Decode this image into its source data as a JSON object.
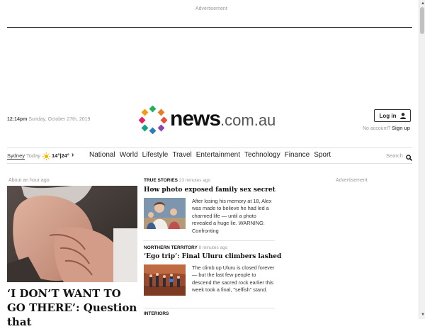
{
  "ads": {
    "top_label": "Advertisement",
    "side_label": "Advertisement"
  },
  "header": {
    "time": "12:14pm",
    "date": "Sunday, October 27th, 2019",
    "logo_main": "news",
    "logo_suffix": ".com.au",
    "login_label": "Log in",
    "no_account": "No account?",
    "signup_label": "Sign up"
  },
  "nav": {
    "location": "Sydney",
    "today": "Today",
    "temp": "14°|24°",
    "items": [
      "National",
      "World",
      "Lifestyle",
      "Travel",
      "Entertainment",
      "Technology",
      "Finance",
      "Sport"
    ],
    "search_label": "Search"
  },
  "main_story": {
    "ago": "About an hour ago",
    "headline": "‘I DON’T WANT TO GO THERE’: Question that"
  },
  "stories": [
    {
      "kicker": "TRUE STORIES",
      "ago": "23 minutes ago",
      "title": "How photo exposed family sex secret",
      "blurb": "After losing his memory at 18, Alex was made to believe he had led a charmed life — until a photo revealed a huge lie. WARNING: Confronting"
    },
    {
      "kicker": "NORTHERN TERRITORY",
      "ago": "8 minutes ago",
      "title": "‘Ego trip’: Final Uluru climbers lashed",
      "blurb": "The climb up Uluru is closed forever — but the last few people to descend the sacred rock earlier this week took a final, \"selfish\" stand."
    },
    {
      "kicker": "INTERIORS",
      "ago": "",
      "title": "",
      "blurb": ""
    }
  ],
  "colors": {
    "logo_dots": [
      "#e74c3c",
      "#f39c12",
      "#27ae60",
      "#2980b9",
      "#8e44ad",
      "#e91e63",
      "#16a085",
      "#d35400"
    ]
  }
}
